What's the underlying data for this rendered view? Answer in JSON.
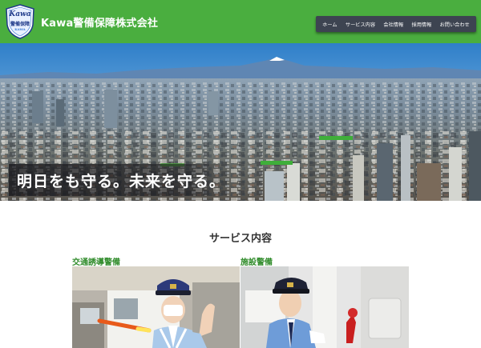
{
  "header": {
    "logo": {
      "line1": "Kawa",
      "line2": "警備保障",
      "line3": "KAWA"
    },
    "company_name": "Kawa警備保障株式会社"
  },
  "nav": {
    "items": [
      "ホーム",
      "サービス内容",
      "会社情報",
      "採用情報",
      "お問い合わせ"
    ]
  },
  "hero": {
    "tagline": "明日をも守る。未来を守る。"
  },
  "services": {
    "title": "サービス内容",
    "items": [
      {
        "label": "交通誘導警備"
      },
      {
        "label": "施設警備"
      }
    ]
  },
  "colors": {
    "header_green": "#4aae3f",
    "nav_bg": "#3d4451",
    "service_label_green": "#2f8b2a"
  }
}
